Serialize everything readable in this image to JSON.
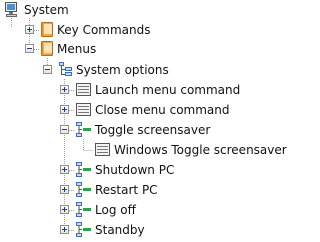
{
  "tree": {
    "items": [
      {
        "label": "System",
        "icon": "computer-icon",
        "expanded": true
      },
      {
        "label": "Key Commands",
        "icon": "folder-icon",
        "expanded": false
      },
      {
        "label": "Menus",
        "icon": "folder-icon",
        "expanded": true
      },
      {
        "label": "System options",
        "icon": "menu-tree-icon",
        "expanded": true
      },
      {
        "label": "Launch menu command",
        "icon": "command-icon",
        "expanded": false
      },
      {
        "label": "Close menu command",
        "icon": "command-icon",
        "expanded": false
      },
      {
        "label": "Toggle screensaver",
        "icon": "menu-item-icon",
        "expanded": true
      },
      {
        "label": "Windows Toggle screensaver",
        "icon": "command-icon"
      },
      {
        "label": "Shutdown PC",
        "icon": "menu-item-icon",
        "expanded": false
      },
      {
        "label": "Restart PC",
        "icon": "menu-item-icon",
        "expanded": false
      },
      {
        "label": "Log off",
        "icon": "menu-item-icon",
        "expanded": false
      },
      {
        "label": "Standby",
        "icon": "menu-item-icon",
        "expanded": false
      }
    ]
  },
  "colors": {
    "folder": "#f0a040",
    "computer_screen": "#4a8fd8",
    "menu_green": "#2fa04a",
    "menu_blue": "#3a6fc4",
    "tree_line": "#a0a0a0"
  }
}
